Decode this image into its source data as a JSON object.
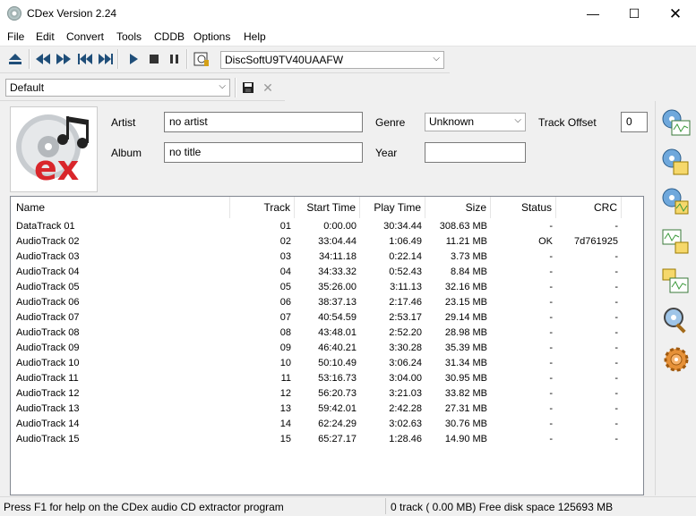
{
  "window": {
    "title": "CDex Version 2.24"
  },
  "menu": [
    "File",
    "Edit",
    "Convert",
    "Tools",
    "CDDB",
    "Options",
    "Help"
  ],
  "drive_select": {
    "value": "DiscSoftU9TV40UAAFW"
  },
  "profile_select": {
    "value": "Default"
  },
  "form": {
    "artist_label": "Artist",
    "artist_value": "no artist",
    "album_label": "Album",
    "album_value": "no title",
    "genre_label": "Genre",
    "genre_value": "Unknown",
    "year_label": "Year",
    "year_value": "",
    "track_offset_label": "Track Offset",
    "track_offset_value": "0"
  },
  "columns": [
    "Name",
    "Track",
    "Start Time",
    "Play Time",
    "Size",
    "Status",
    "CRC"
  ],
  "tracks": [
    {
      "name": "DataTrack 01",
      "track": "01",
      "start": "0:00.00",
      "play": "30:34.44",
      "size": "308.63 MB",
      "status": "-",
      "crc": "-"
    },
    {
      "name": "AudioTrack 02",
      "track": "02",
      "start": "33:04.44",
      "play": "1:06.49",
      "size": "11.21 MB",
      "status": "OK",
      "crc": "7d761925"
    },
    {
      "name": "AudioTrack 03",
      "track": "03",
      "start": "34:11.18",
      "play": "0:22.14",
      "size": "3.73 MB",
      "status": "-",
      "crc": "-"
    },
    {
      "name": "AudioTrack 04",
      "track": "04",
      "start": "34:33.32",
      "play": "0:52.43",
      "size": "8.84 MB",
      "status": "-",
      "crc": "-"
    },
    {
      "name": "AudioTrack 05",
      "track": "05",
      "start": "35:26.00",
      "play": "3:11.13",
      "size": "32.16 MB",
      "status": "-",
      "crc": "-"
    },
    {
      "name": "AudioTrack 06",
      "track": "06",
      "start": "38:37.13",
      "play": "2:17.46",
      "size": "23.15 MB",
      "status": "-",
      "crc": "-"
    },
    {
      "name": "AudioTrack 07",
      "track": "07",
      "start": "40:54.59",
      "play": "2:53.17",
      "size": "29.14 MB",
      "status": "-",
      "crc": "-"
    },
    {
      "name": "AudioTrack 08",
      "track": "08",
      "start": "43:48.01",
      "play": "2:52.20",
      "size": "28.98 MB",
      "status": "-",
      "crc": "-"
    },
    {
      "name": "AudioTrack 09",
      "track": "09",
      "start": "46:40.21",
      "play": "3:30.28",
      "size": "35.39 MB",
      "status": "-",
      "crc": "-"
    },
    {
      "name": "AudioTrack 10",
      "track": "10",
      "start": "50:10.49",
      "play": "3:06.24",
      "size": "31.34 MB",
      "status": "-",
      "crc": "-"
    },
    {
      "name": "AudioTrack 11",
      "track": "11",
      "start": "53:16.73",
      "play": "3:04.00",
      "size": "30.95 MB",
      "status": "-",
      "crc": "-"
    },
    {
      "name": "AudioTrack 12",
      "track": "12",
      "start": "56:20.73",
      "play": "3:21.03",
      "size": "33.82 MB",
      "status": "-",
      "crc": "-"
    },
    {
      "name": "AudioTrack 13",
      "track": "13",
      "start": "59:42.01",
      "play": "2:42.28",
      "size": "27.31 MB",
      "status": "-",
      "crc": "-"
    },
    {
      "name": "AudioTrack 14",
      "track": "14",
      "start": "62:24.29",
      "play": "3:02.63",
      "size": "30.76 MB",
      "status": "-",
      "crc": "-"
    },
    {
      "name": "AudioTrack 15",
      "track": "15",
      "start": "65:27.17",
      "play": "1:28.46",
      "size": "14.90 MB",
      "status": "-",
      "crc": "-"
    }
  ],
  "status": {
    "help_text": "Press F1 for help on the CDex audio CD extractor program",
    "disk_text": "0 track ( 0.00 MB) Free disk space 125693 MB"
  },
  "logo_text": "ex"
}
